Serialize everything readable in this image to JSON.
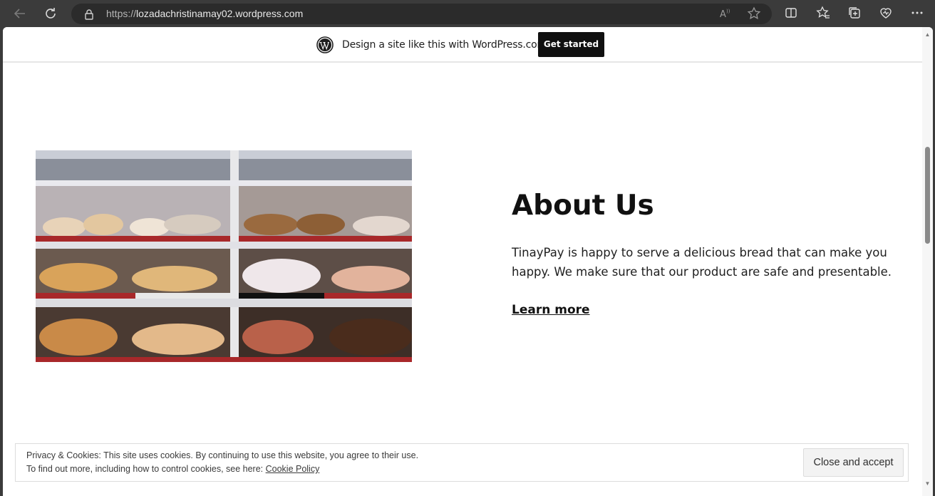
{
  "browser": {
    "url_scheme": "https://",
    "url_host": "lozadachristinamay02.wordpress.com",
    "back_icon": "arrow-left-icon",
    "refresh_icon": "refresh-icon",
    "read_aloud_icon": "À",
    "favorite_icon": "star-icon"
  },
  "wp_banner": {
    "text": "Design a site like this with WordPress.com",
    "cta": "Get started"
  },
  "about": {
    "title": "About Us",
    "body": "TinayPay is happy to serve a delicious bread that can make you happy. We make sure that our product are safe and presentable.",
    "link": "Learn more"
  },
  "cookie": {
    "line1": "Privacy & Cookies: This site uses cookies. By continuing to use this website, you agree to their use.",
    "line2_prefix": "To find out more, including how to control cookies, see here: ",
    "policy_link": "Cookie Policy",
    "accept_button": "Close and accept"
  }
}
